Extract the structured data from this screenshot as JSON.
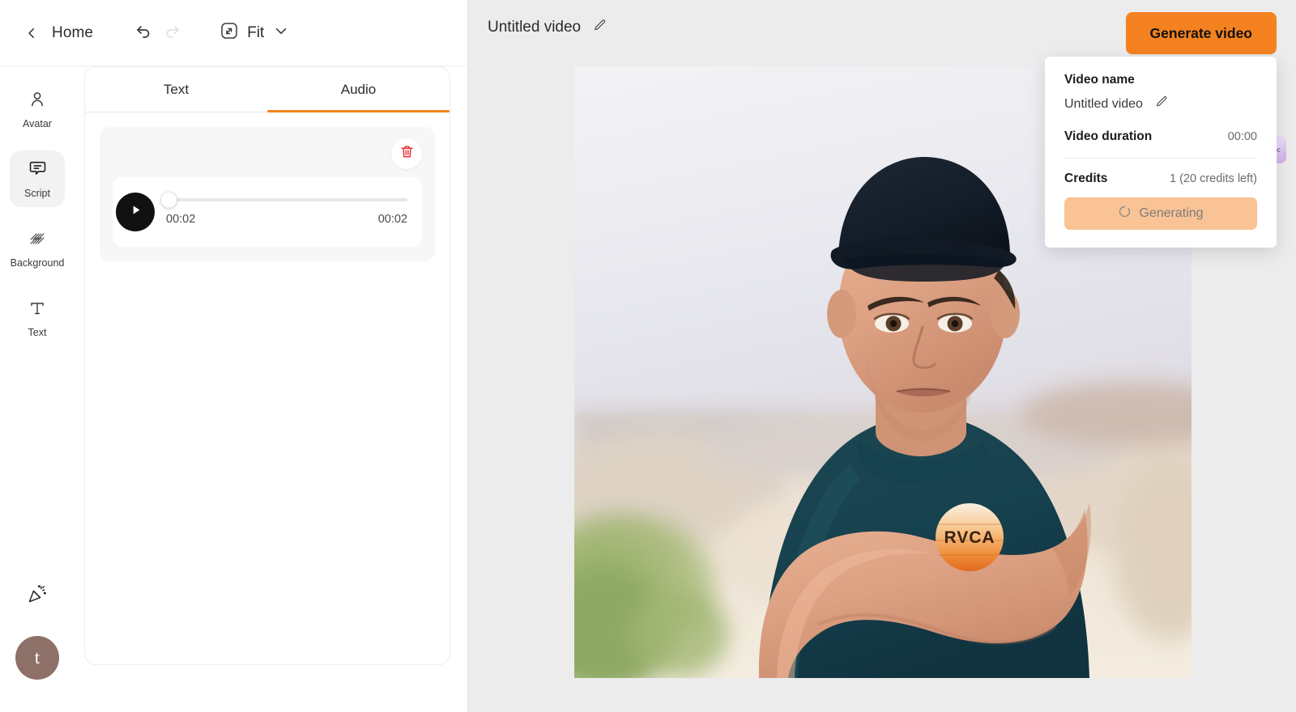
{
  "toolbar": {
    "back_label": "Home",
    "undo_icon": "undo-icon",
    "redo_icon": "redo-icon",
    "fit_label": "Fit",
    "fit_icon": "fit-screen-icon",
    "chevron_icon": "chevron-down-icon"
  },
  "rail": {
    "items": [
      {
        "label": "Avatar",
        "icon": "person-icon",
        "active": false
      },
      {
        "label": "Script",
        "icon": "speech-bubble-icon",
        "active": true
      },
      {
        "label": "Background",
        "icon": "hatch-pattern-icon",
        "active": false
      },
      {
        "label": "Text",
        "icon": "text-t-icon",
        "active": false
      }
    ],
    "bottom_icon": "party-popper-icon",
    "avatar_initial": "t"
  },
  "panel": {
    "tabs": [
      {
        "label": "Text",
        "active": false
      },
      {
        "label": "Audio",
        "active": true
      }
    ],
    "audio": {
      "delete_icon": "trash-icon",
      "play_icon": "play-icon",
      "current_time": "00:02",
      "total_time": "00:02",
      "progress_percent": 0
    }
  },
  "stage": {
    "video_title": "Untitled video",
    "edit_icon": "pencil-icon",
    "generate_button": "Generate video"
  },
  "popup": {
    "name_label": "Video name",
    "name_value": "Untitled video",
    "edit_icon": "pencil-icon",
    "duration_label": "Video duration",
    "duration_value": "00:00",
    "credits_label": "Credits",
    "credits_value": "1 (20 credits left)",
    "generating_label": "Generating",
    "spinner_icon": "spinner-icon"
  },
  "floating": {
    "chip_face": ">_<"
  },
  "colors": {
    "accent_orange": "#f58220",
    "generating_bg": "#f9c395",
    "avatar_brown": "#8d7068",
    "delete_red": "#ed1c24",
    "stage_bg": "#ececec"
  }
}
